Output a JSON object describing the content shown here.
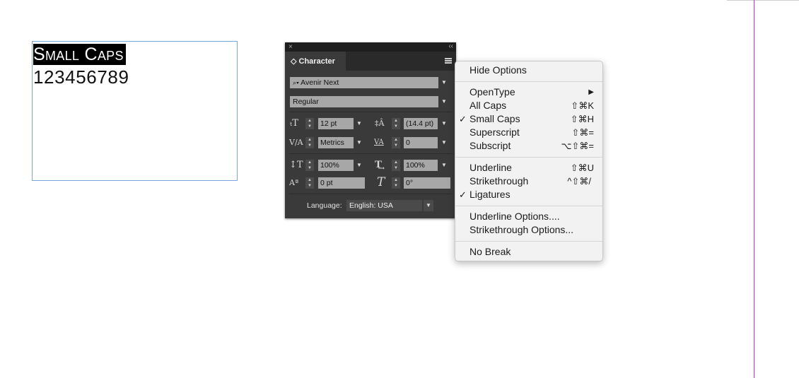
{
  "document": {
    "small_caps_first": "S",
    "small_caps_rest1": "MALL",
    "small_caps_space": " C",
    "small_caps_rest2": "APS",
    "digits": "123456789"
  },
  "panel": {
    "close_glyph": "×",
    "collapse_glyph": "‹‹",
    "tab_label": "◇ Character",
    "font_family": "Avenir Next",
    "font_style": "Regular",
    "font_size": "12 pt",
    "leading": "(14.4 pt)",
    "kerning": "Metrics",
    "tracking": "0",
    "vertical_scale": "100%",
    "horizontal_scale": "100%",
    "baseline_shift": "0 pt",
    "skew": "0°",
    "language_label": "Language:",
    "language_value": "English: USA",
    "icons": {
      "font_size": "font-size-icon",
      "leading": "leading-icon",
      "kerning": "kerning-icon",
      "tracking": "tracking-icon",
      "vertical_scale": "vertical-scale-icon",
      "horizontal_scale": "horizontal-scale-icon",
      "baseline_shift": "baseline-shift-icon",
      "skew": "skew-icon"
    }
  },
  "menu": {
    "hide_options": "Hide Options",
    "opentype": "OpenType",
    "all_caps": "All Caps",
    "all_caps_shortcut": "⇧⌘K",
    "small_caps": "Small Caps",
    "small_caps_shortcut": "⇧⌘H",
    "superscript": "Superscript",
    "superscript_shortcut": "⇧⌘=",
    "subscript": "Subscript",
    "subscript_shortcut": "⌥⇧⌘=",
    "underline": "Underline",
    "underline_shortcut": "⇧⌘U",
    "strikethrough": "Strikethrough",
    "strikethrough_shortcut": "^⇧⌘/",
    "ligatures": "Ligatures",
    "underline_options": "Underline Options....",
    "strikethrough_options": "Strikethrough Options...",
    "no_break": "No Break",
    "checkmark": "✓",
    "submenu_arrow": "▶"
  },
  "colors": {
    "panel_bg": "#3a3a3a",
    "margin_guide": "#b13cc4",
    "frame_border": "#7aa6d8"
  }
}
